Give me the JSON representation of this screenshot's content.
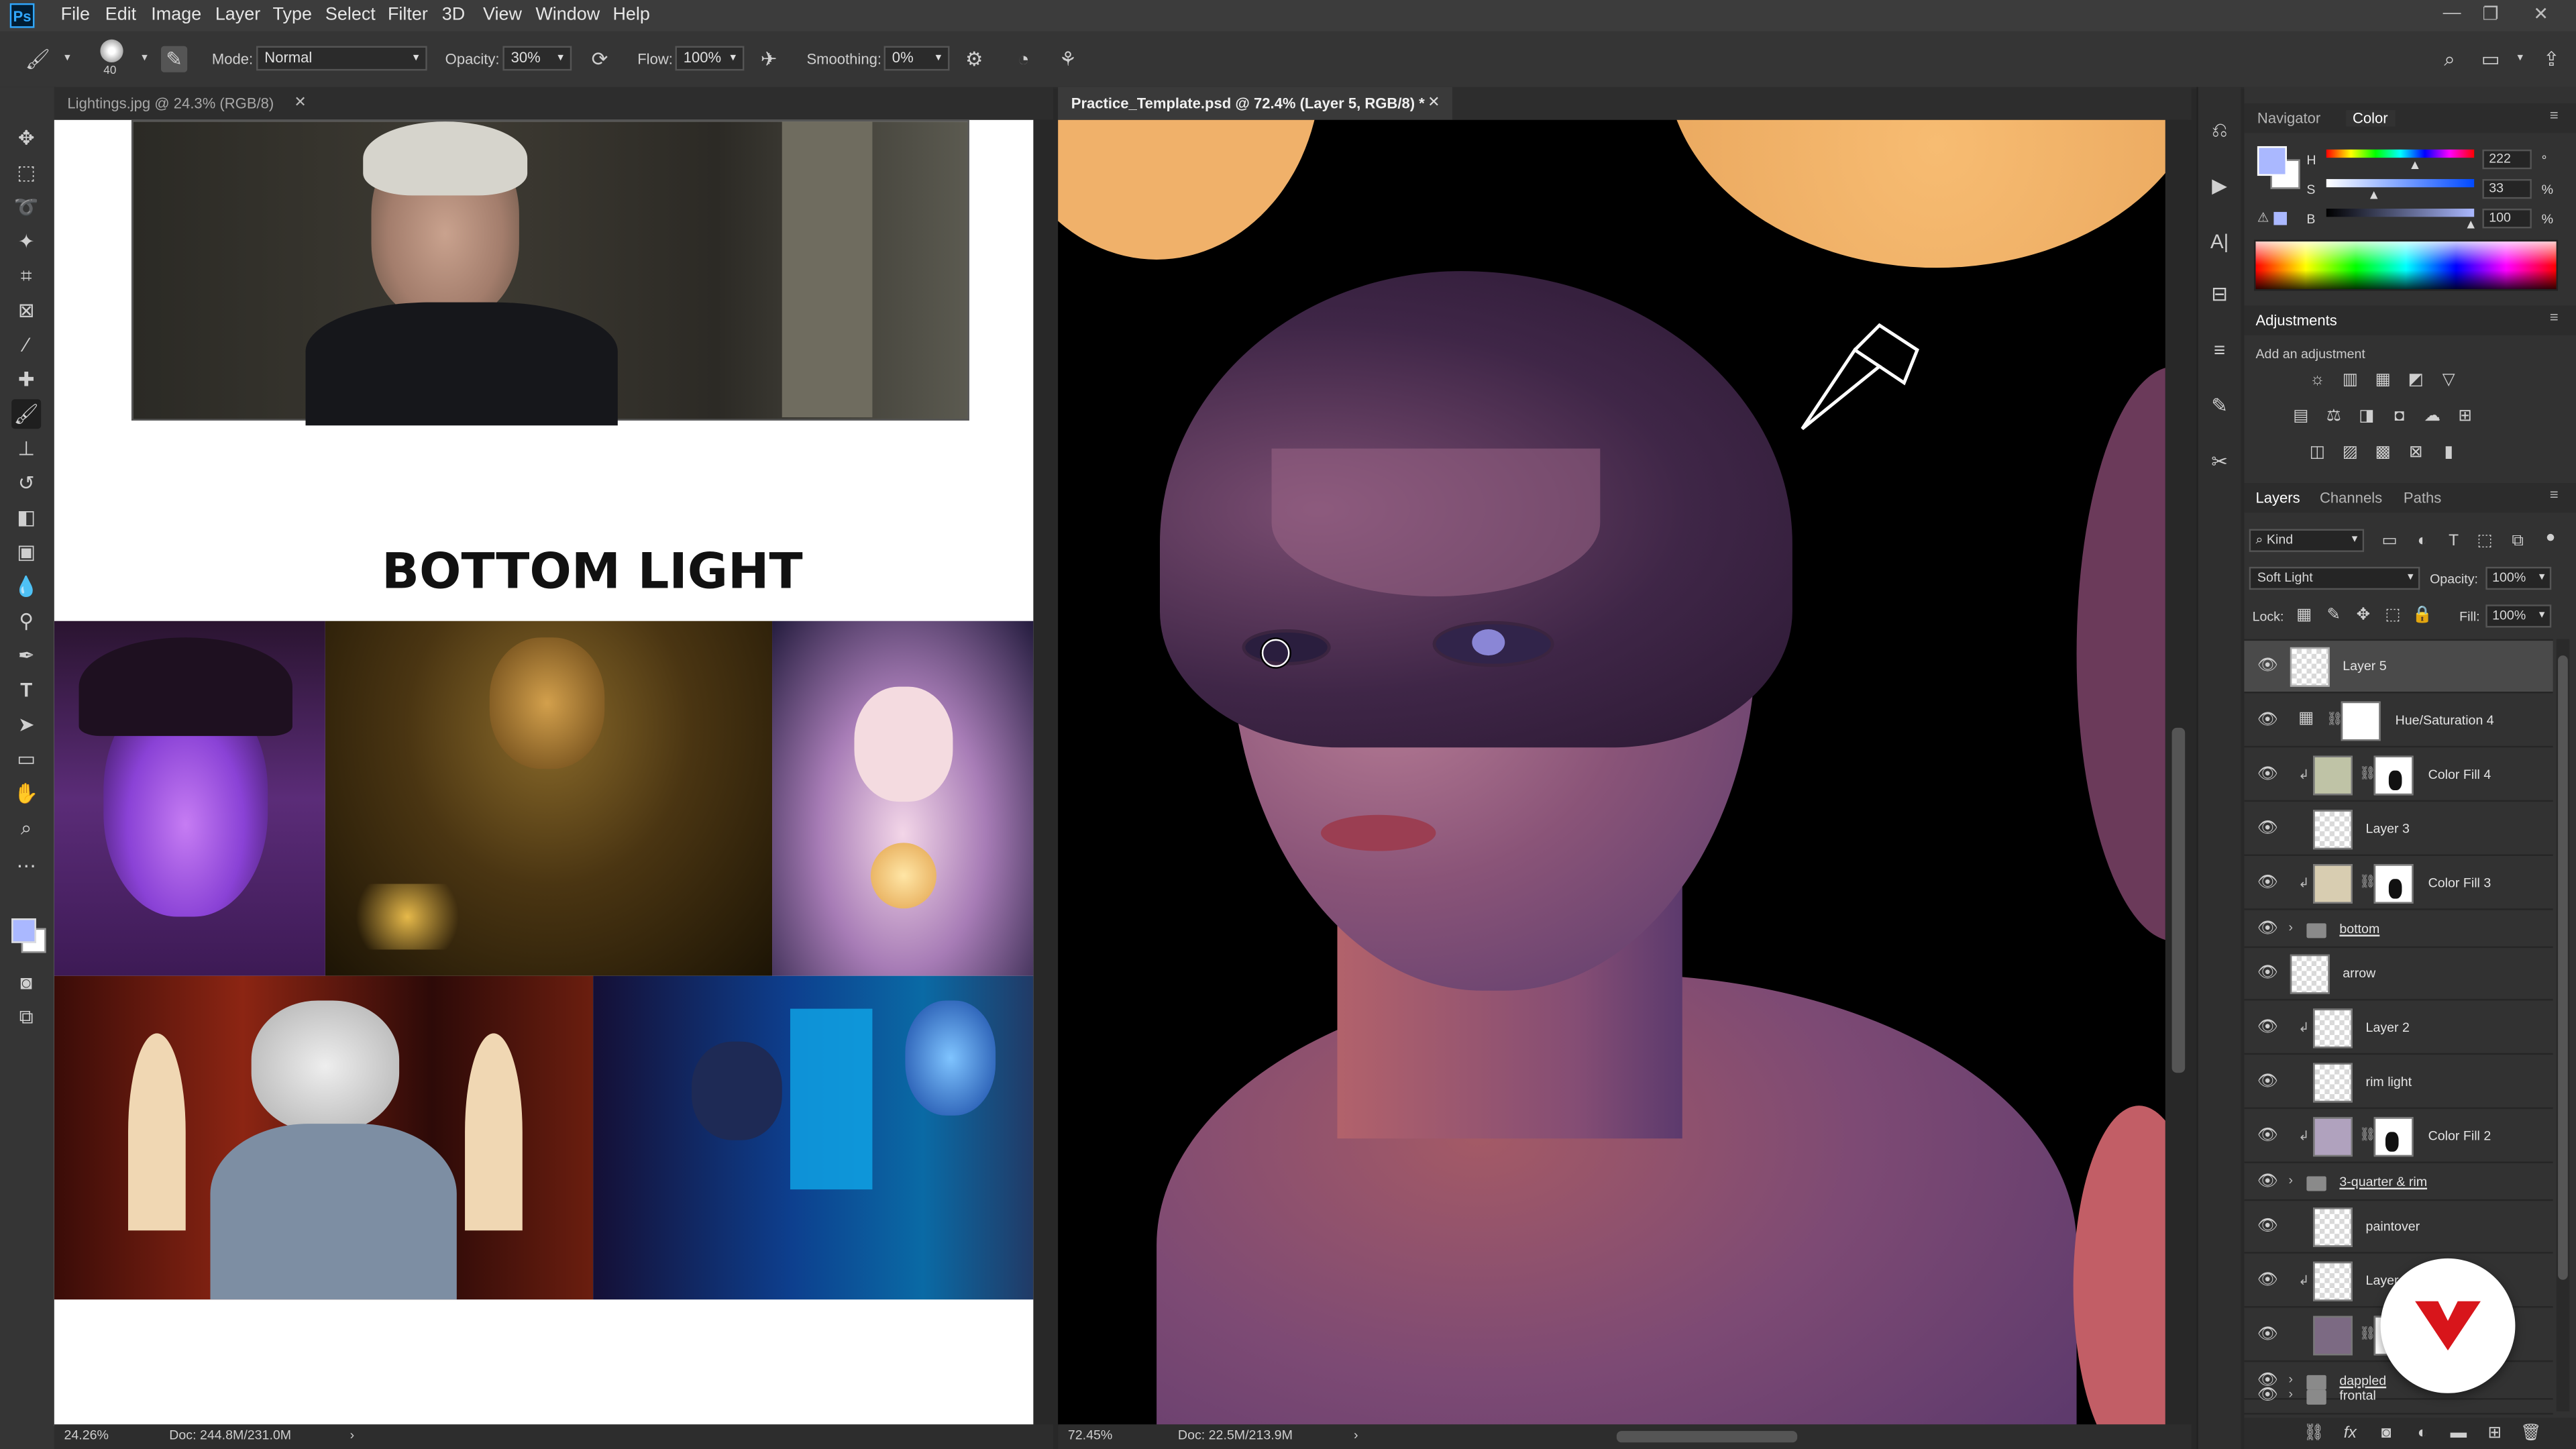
{
  "menu": {
    "app_icon": "Ps",
    "items": [
      "File",
      "Edit",
      "Image",
      "Layer",
      "Type",
      "Select",
      "Filter",
      "3D",
      "View",
      "Window",
      "Help"
    ]
  },
  "options": {
    "brush_size": "40",
    "mode_label": "Mode:",
    "mode_value": "Normal",
    "opacity_label": "Opacity:",
    "opacity_value": "30%",
    "flow_label": "Flow:",
    "flow_value": "100%",
    "smoothing_label": "Smoothing:",
    "smoothing_value": "0%"
  },
  "left_doc": {
    "tab_title": "Lightings.jpg @ 24.3% (RGB/8)",
    "heading": "BOTTOM LIGHT",
    "zoom": "24.26%",
    "doc_size": "Doc: 244.8M/231.0M"
  },
  "right_doc": {
    "tab_title": "Practice_Template.psd @ 72.4% (Layer 5, RGB/8) *",
    "zoom": "72.45%",
    "doc_size": "Doc: 22.5M/213.9M"
  },
  "panels": {
    "tabs_top": [
      "Navigator",
      "Color"
    ],
    "color": {
      "h_label": "H",
      "h_value": "222",
      "h_unit": "°",
      "s_label": "S",
      "s_value": "33",
      "s_unit": "%",
      "b_label": "B",
      "b_value": "100",
      "b_unit": "%",
      "foreground": "#aab8ff"
    },
    "adjustments_title": "Adjustments",
    "adjustments_hint": "Add an adjustment",
    "layers_tabs": [
      "Layers",
      "Channels",
      "Paths"
    ],
    "kind_label": "Kind",
    "blend_mode": "Soft Light",
    "opacity_label": "Opacity:",
    "opacity_value": "100%",
    "lock_label": "Lock:",
    "fill_label": "Fill:",
    "fill_value": "100%",
    "layers": [
      {
        "name": "Layer 5",
        "type": "pixel",
        "selected": true
      },
      {
        "name": "Hue/Saturation 4",
        "type": "adjustment"
      },
      {
        "name": "Color Fill 4",
        "type": "fill",
        "color": "#bfc3a6",
        "clipped": true
      },
      {
        "name": "Layer 3",
        "type": "pixel"
      },
      {
        "name": "Color Fill 3",
        "type": "fill",
        "color": "#d8cdb1",
        "clipped": true
      },
      {
        "name": "bottom",
        "type": "group"
      },
      {
        "name": "arrow",
        "type": "pixel"
      },
      {
        "name": "Layer 2",
        "type": "pixel",
        "clipped": true
      },
      {
        "name": "rim light",
        "type": "pixel"
      },
      {
        "name": "Color Fill 2",
        "type": "fill",
        "color": "#b0a2be",
        "clipped": true
      },
      {
        "name": "3-quarter & rim",
        "type": "group"
      },
      {
        "name": "paintover",
        "type": "pixel"
      },
      {
        "name": "Layer 1",
        "type": "pixel",
        "clipped": true
      },
      {
        "name": "",
        "type": "fill",
        "color": "#7c6a83"
      },
      {
        "name": "dappled",
        "type": "group"
      },
      {
        "name": "frontal",
        "type": "group"
      }
    ]
  }
}
